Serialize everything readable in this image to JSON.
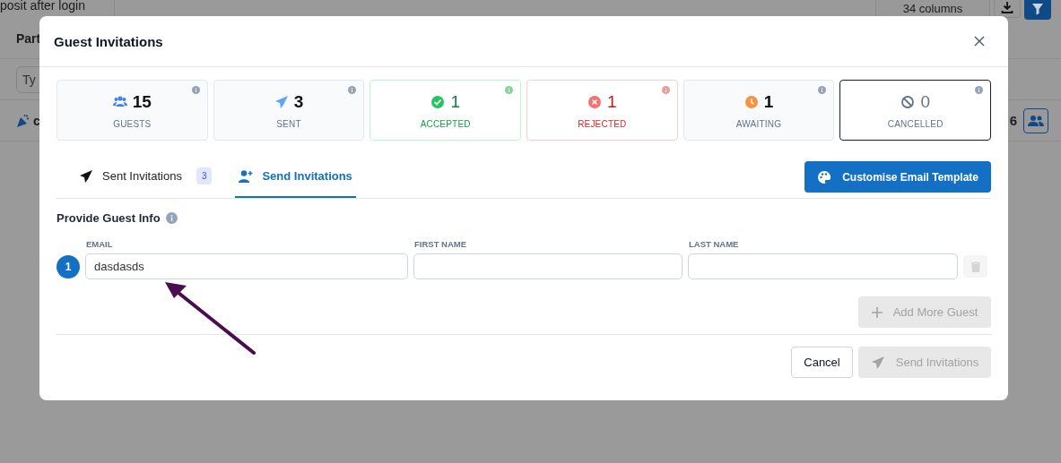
{
  "background": {
    "top_cell": "posit after login",
    "columns_button": "34 columns",
    "column_header": "Part",
    "filter_placeholder": "Ty",
    "row_text": "c",
    "row_count": "6"
  },
  "dialog": {
    "title": "Guest Invitations"
  },
  "stats": [
    {
      "kind": "guests",
      "value": "15",
      "label": "GUESTS",
      "selected": false
    },
    {
      "kind": "sent",
      "value": "3",
      "label": "SENT",
      "selected": false
    },
    {
      "kind": "accepted",
      "value": "1",
      "label": "ACCEPTED",
      "selected": false
    },
    {
      "kind": "rejected",
      "value": "1",
      "label": "REJECTED",
      "selected": false
    },
    {
      "kind": "awaiting",
      "value": "1",
      "label": "AWAITING",
      "selected": false
    },
    {
      "kind": "cancelled",
      "value": "0",
      "label": "CANCELLED",
      "selected": true
    }
  ],
  "tabs": [
    {
      "kind": "sent",
      "label": "Sent Invitations",
      "count": "3",
      "selected": false
    },
    {
      "kind": "send",
      "label": "Send Invitations",
      "selected": true
    }
  ],
  "customise_button": "Customise Email Template",
  "section_title": "Provide Guest Info",
  "columns": [
    "EMAIL",
    "FIRST NAME",
    "LAST NAME"
  ],
  "guests": [
    {
      "number": "1",
      "email": "dasdasds"
    }
  ],
  "add_button": {
    "label": "Add More Guest",
    "disabled": true
  },
  "cancel_button": "Cancel",
  "send_button": {
    "label": "Send Invitations",
    "disabled": true
  }
}
